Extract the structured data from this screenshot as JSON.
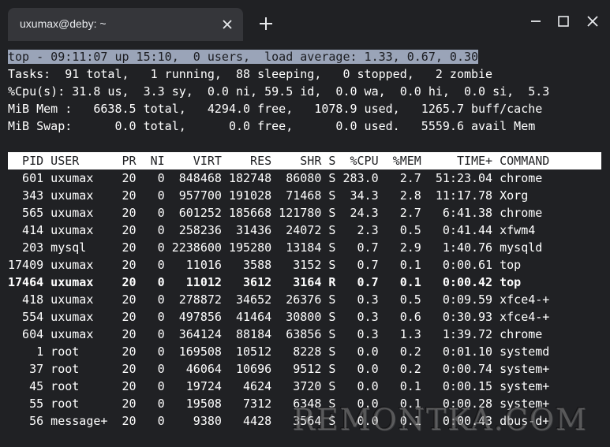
{
  "window": {
    "tab_title": "uxumax@deby: ~",
    "new_tab_glyph": "+",
    "controls": [
      "minimize-icon",
      "maximize-icon",
      "close-icon"
    ]
  },
  "summary": [
    "top - 09:11:07 up 15:10,  0 users,  load average: 1.33, 0.67, 0.30",
    "Tasks:  91 total,   1 running,  88 sleeping,   0 stopped,   2 zombie",
    "%Cpu(s): 31.8 us,  3.3 sy,  0.0 ni, 59.5 id,  0.0 wa,  0.0 hi,  0.0 si,  5.3",
    "MiB Mem :   6638.5 total,   4294.0 free,   1078.9 used,   1265.7 buff/cache",
    "MiB Swap:      0.0 total,      0.0 free,      0.0 used.   5559.6 avail Mem"
  ],
  "table_header": "  PID USER      PR  NI    VIRT    RES    SHR S  %CPU  %MEM     TIME+ COMMAND",
  "rows": [
    "  601 uxumax    20   0  848468 182748  86080 S 283.0   2.7  51:23.04 chrome",
    "  343 uxumax    20   0  957700 191028  71468 S  34.3   2.8  11:17.78 Xorg",
    "  565 uxumax    20   0  601252 185668 121780 S  24.3   2.7   6:41.38 chrome",
    "  414 uxumax    20   0  258236  31436  24072 S   2.3   0.5   0:41.44 xfwm4",
    "  203 mysql     20   0 2238600 195280  13184 S   0.7   2.9   1:40.76 mysqld",
    "17409 uxumax    20   0   11016   3588   3152 S   0.7   0.1   0:00.61 top",
    "17464 uxumax    20   0   11012   3612   3164 R   0.7   0.1   0:00.42 top",
    "  418 uxumax    20   0  278872  34652  26376 S   0.3   0.5   0:09.59 xfce4-+",
    "  554 uxumax    20   0  497856  41464  30800 S   0.3   0.6   0:30.93 xfce4-+",
    "  604 uxumax    20   0  364124  88184  63856 S   0.3   1.3   1:39.72 chrome",
    "    1 root      20   0  169508  10512   8228 S   0.0   0.2   0:01.10 systemd",
    "   37 root      20   0   46064  10696   9512 S   0.0   0.2   0:00.74 system+",
    "   45 root      20   0   19724   4624   3720 S   0.0   0.1   0:00.15 system+",
    "   55 root      20   0   19508   7312   6348 S   0.0   0.1   0:00.28 system+",
    "   56 message+  20   0    9380   4428   3564 S   0.0   0.1   0:00.43 dbus-d+"
  ],
  "watermark": "REMONTKA.COM",
  "colors": {
    "background": "#202124",
    "tab": "#35363a",
    "text": "#ffffff",
    "highlight": "#9aa4b8"
  }
}
